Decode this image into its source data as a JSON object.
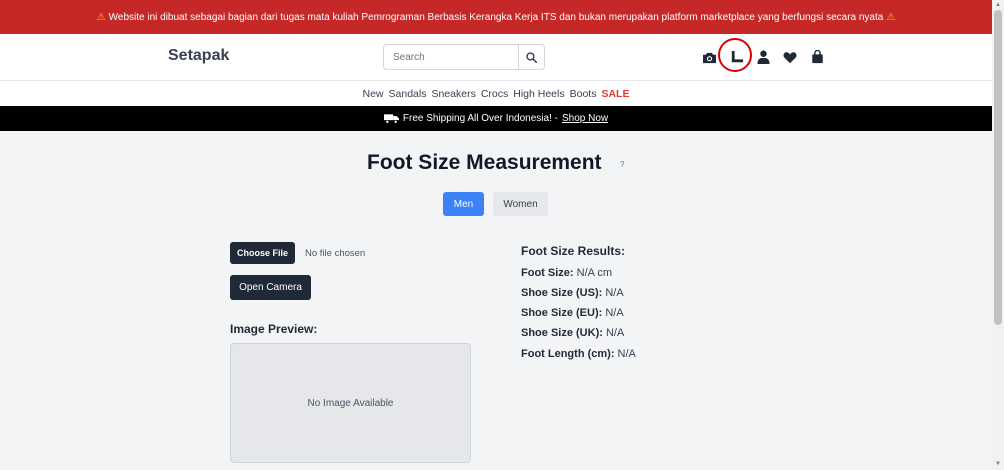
{
  "banner": {
    "text": "Website ini dibuat sebagai bagian dari tugas mata kuliah Pemrograman Berbasis Kerangka Kerja ITS dan bukan merupakan platform marketplace yang berfungsi secara nyata",
    "icon": "warning-icon",
    "bg_color": "#c62828"
  },
  "header": {
    "logo": "Setapak",
    "search_placeholder": "Search",
    "icons": [
      "search-icon",
      "camera-icon",
      "ruler-icon",
      "user-icon",
      "heart-icon",
      "shopping-bag-icon"
    ]
  },
  "categories": [
    "New",
    "Sandals",
    "Sneakers",
    "Crocs",
    "High Heels",
    "Boots"
  ],
  "sale_label": "SALE",
  "shipping": {
    "text": "Free Shipping All Over Indonesia! -",
    "link": "Shop Now",
    "icon": "truck-icon"
  },
  "main": {
    "title": "Foot Size Measurement",
    "help": "?",
    "gender_tabs": [
      "Men",
      "Women"
    ],
    "selected_gender": "Men",
    "choose_file": "Choose File",
    "no_file": "No file chosen",
    "open_camera": "Open Camera",
    "preview_label": "Image Preview:",
    "no_image": "No Image Available"
  },
  "results": {
    "title": "Foot Size Results:",
    "rows": [
      {
        "label": "Foot Size:",
        "value": "N/A cm"
      },
      {
        "label": "Shoe Size (US):",
        "value": "N/A"
      },
      {
        "label": "Shoe Size (EU):",
        "value": "N/A"
      },
      {
        "label": "Shoe Size (UK):",
        "value": "N/A"
      },
      {
        "label": "Foot Length (cm):",
        "value": "N/A"
      }
    ]
  },
  "colors": {
    "accent": "#3b82f6",
    "dark_button": "#1f2937",
    "sale": "#e53935",
    "highlight_circle": "#e00000"
  }
}
